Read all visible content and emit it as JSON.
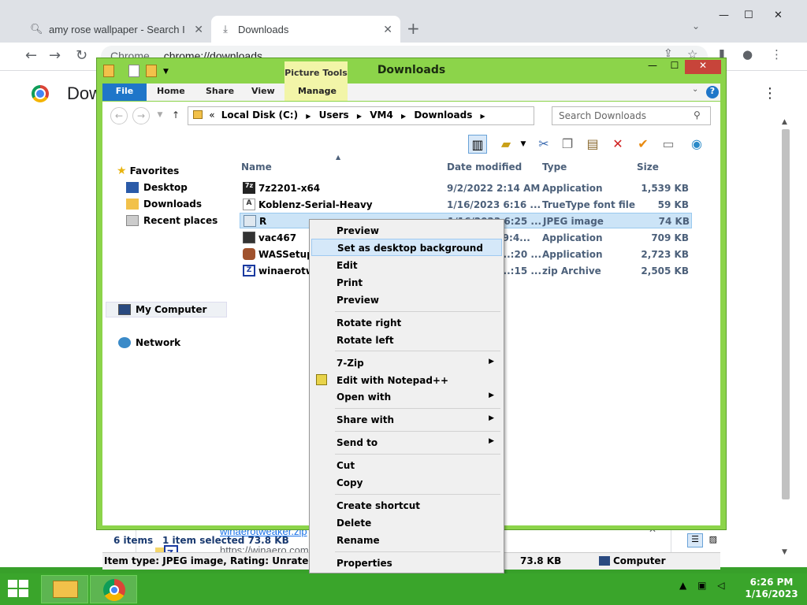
{
  "chrome": {
    "tabs": [
      {
        "label": "amy rose wallpaper - Search I",
        "icon": "search-icon"
      },
      {
        "label": "Downloads",
        "icon": "download-icon"
      }
    ],
    "omnibox_prefix": "Chrome",
    "omnibox_url": "chrome://downloads",
    "page_title": "Dow",
    "download_item": {
      "link": "winaerotweaker.zip",
      "url": "https://winaero.com"
    }
  },
  "explorer": {
    "title": "Downloads",
    "context_tab": "Picture Tools",
    "ribbon_tabs": [
      "File",
      "Home",
      "Share",
      "View",
      "Manage"
    ],
    "address": {
      "prefix": "«",
      "parts": [
        "Local Disk (C:)",
        "Users",
        "VM4",
        "Downloads"
      ]
    },
    "search_placeholder": "Search Downloads",
    "nav": {
      "favorites": "Favorites",
      "desktop": "Desktop",
      "downloads": "Downloads",
      "recent": "Recent places",
      "mycomputer": "My Computer",
      "network": "Network"
    },
    "columns": {
      "name": "Name",
      "date": "Date modified",
      "type": "Type",
      "size": "Size"
    },
    "files": [
      {
        "name": "7z2201-x64",
        "date": "9/2/2022 2:14 AM",
        "type": "Application",
        "size": "1,539 KB"
      },
      {
        "name": "Koblenz-Serial-Heavy",
        "date": "1/16/2023 6:16 ...",
        "type": "TrueType font file",
        "size": "59 KB"
      },
      {
        "name": "R",
        "date": "1/16/2023 6:25 ...",
        "type": "JPEG image",
        "size": "74 KB"
      },
      {
        "name": "vac467",
        "date": "...9:4...",
        "type": "Application",
        "size": "709 KB"
      },
      {
        "name": "WASSetup_",
        "date": "...:20 ...",
        "type": "Application",
        "size": "2,723 KB"
      },
      {
        "name": "winaerotwe",
        "date": "...:15 ...",
        "type": "zip Archive",
        "size": "2,505 KB"
      }
    ],
    "status": {
      "count": "6 items",
      "selected": "1 item selected  73.8 KB"
    },
    "details": {
      "text": "Item type: JPEG image, Rating: Unrated, Dimen",
      "size": "73.8 KB",
      "location": "Computer"
    }
  },
  "context_menu": {
    "items": [
      "Preview",
      "Set as desktop background",
      "Edit",
      "Print",
      "Preview",
      "Rotate right",
      "Rotate left",
      "7-Zip",
      "Edit with Notepad++",
      "Open with",
      "Share with",
      "Send to",
      "Cut",
      "Copy",
      "Create shortcut",
      "Delete",
      "Rename",
      "Properties"
    ],
    "highlighted_index": 1
  },
  "taskbar": {
    "time": "6:26 PM",
    "date": "1/16/2023"
  },
  "colors": {
    "accent": "#1f76c9",
    "window_frame": "#8cd44a",
    "taskbar": "#3aa52b",
    "close": "#c7443a"
  }
}
